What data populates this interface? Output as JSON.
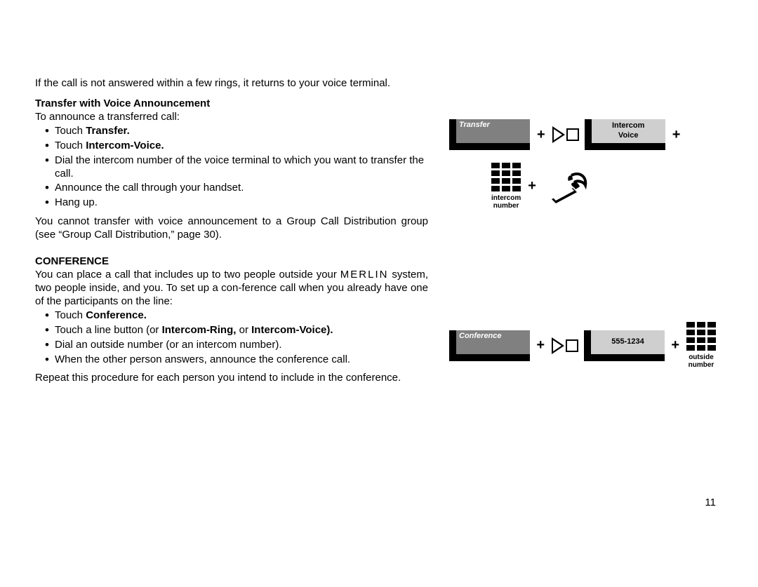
{
  "intro": "If the call is not answered within a few rings, it returns to your voice  terminal.",
  "section1_heading": "Transfer with Voice Announcement",
  "section1_lead": "To announce a transferred call:",
  "section1_bullets": {
    "b1_pre": "Touch ",
    "b1_bold": "Transfer.",
    "b2_pre": "Touch ",
    "b2_bold": "Intercom-Voice.",
    "b3": "Dial the intercom number of the voice terminal to which you want to transfer the call.",
    "b4": "Announce the call through your handset.",
    "b5": "Hang up."
  },
  "section1_tail": "You cannot transfer with voice announcement to a Group Call Distribution group (see “Group Call Distribution,” page 30).",
  "section2_heading": "CONFERENCE",
  "section2_lead_pre": "You can place a call that includes up to two people outside your ",
  "section2_lead_brand": "MERLIN",
  "section2_lead_post": " system, two people inside, and you. To set up a con-ference call when you already have one of the participants on the line:",
  "section2_bullets": {
    "c1_pre": "Touch ",
    "c1_bold": "Conference.",
    "c2_pre": "Touch a line button (or ",
    "c2_bold1": "Intercom-Ring,",
    "c2_mid": " or ",
    "c2_bold2": "Intercom-Voice).",
    "c3": "Dial an outside number (or an intercom number).",
    "c4": "When the other person answers, announce the conference call."
  },
  "section2_tail": "Repeat this procedure for each person you intend to include in the  conference.",
  "fig1": {
    "btn_transfer": "Transfer",
    "btn_intercom_line1": "Intercom",
    "btn_intercom_line2": "Voice",
    "keypad_label_l1": "intercom",
    "keypad_label_l2": "number"
  },
  "fig2": {
    "btn_conference": "Conference",
    "btn_number": "555-1234",
    "keypad_label_l1": "outside",
    "keypad_label_l2": "number"
  },
  "plus": "+",
  "page_number": "11"
}
